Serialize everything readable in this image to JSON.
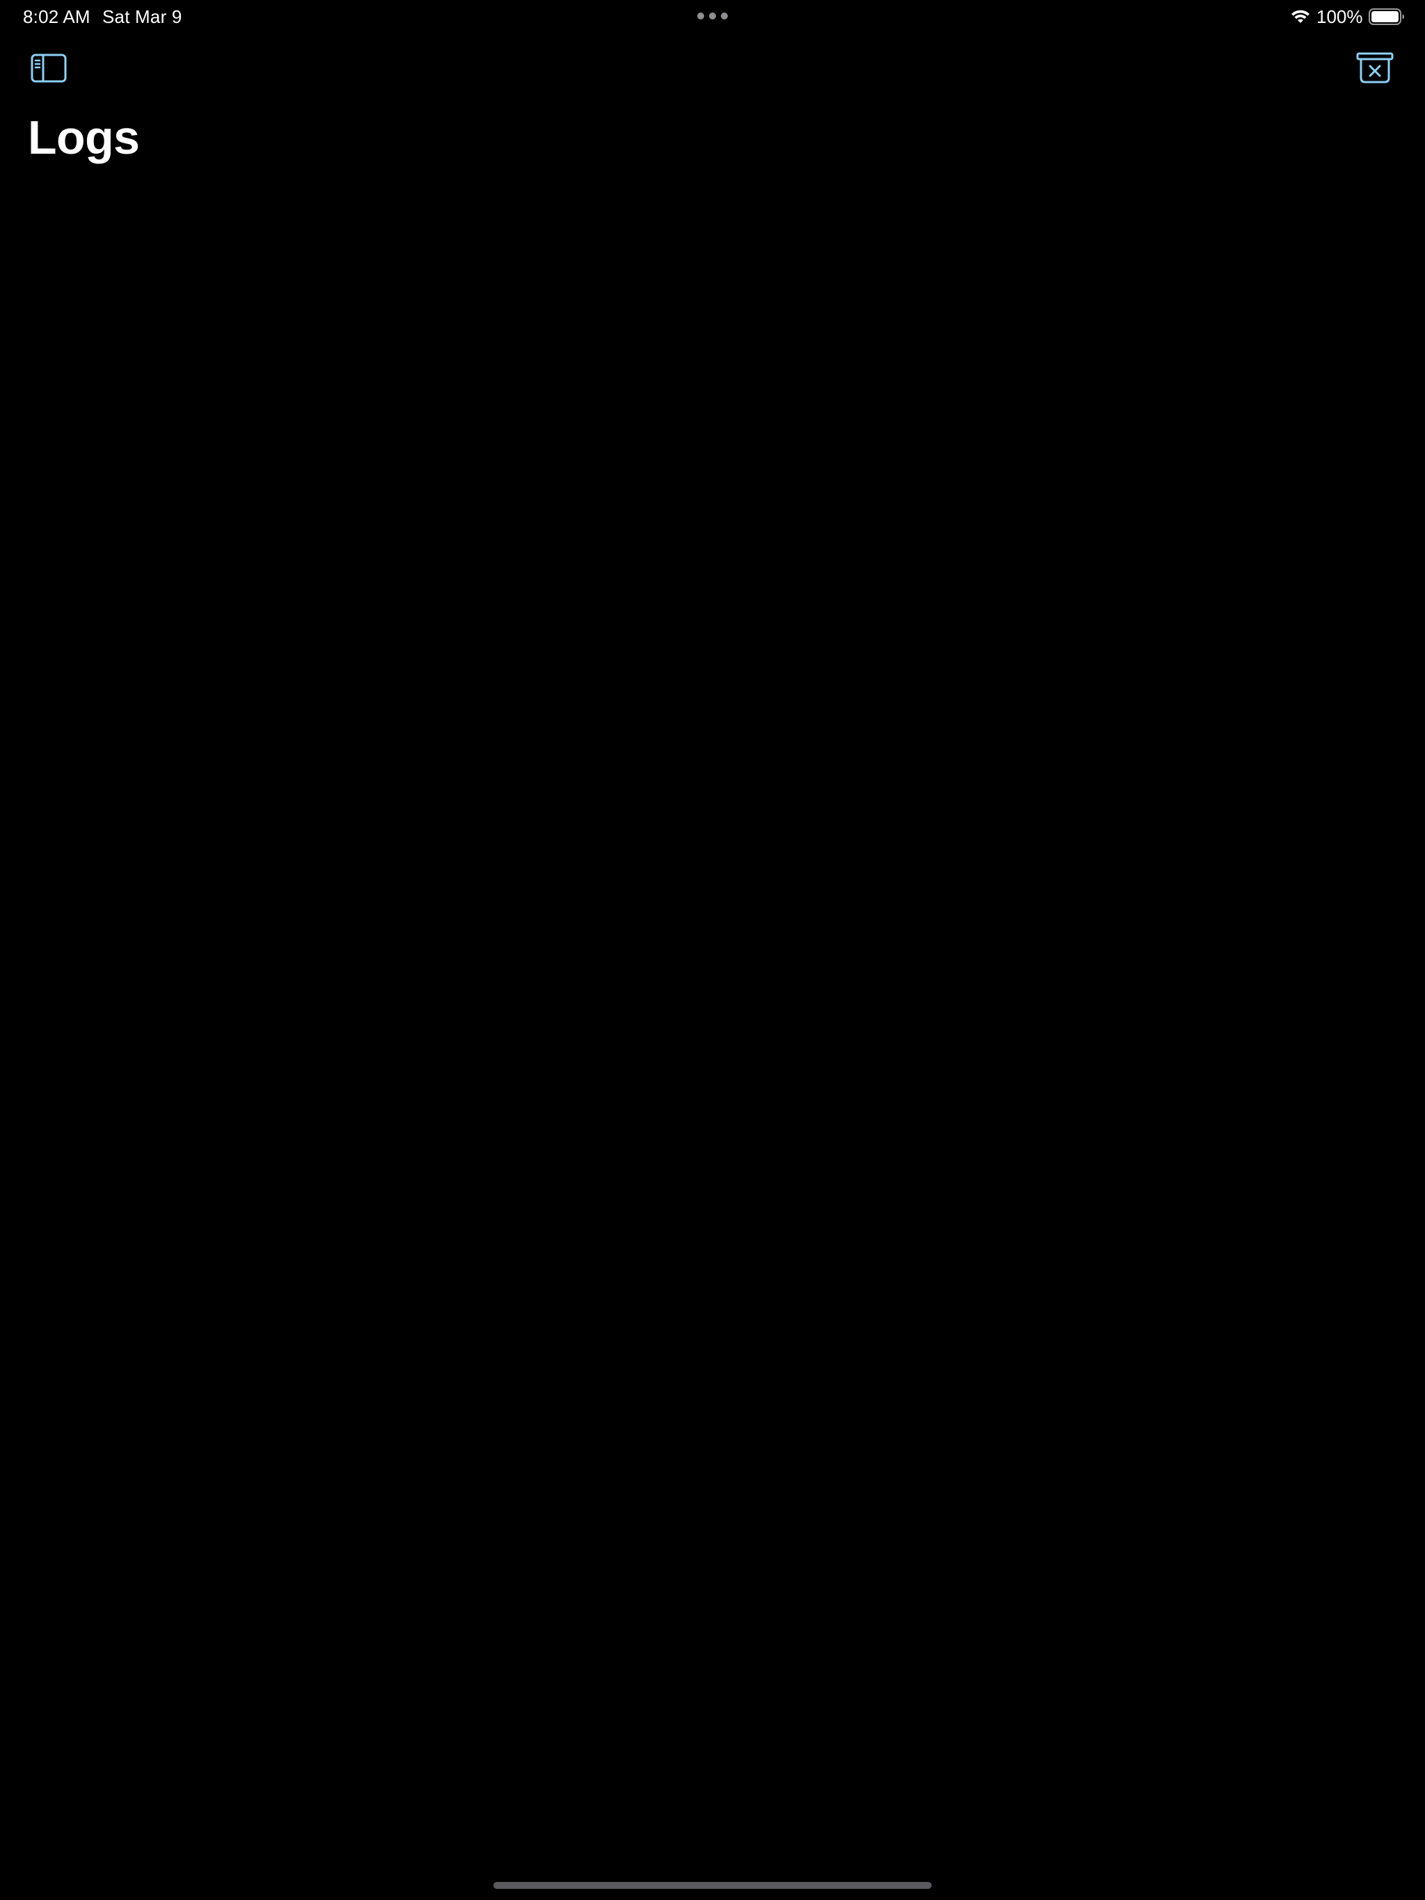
{
  "status_bar": {
    "time": "8:02 AM",
    "date": "Sat Mar 9",
    "battery_percent": "100%",
    "battery_level": 1.0,
    "icons": [
      "wifi-icon",
      "battery-icon",
      "multitask-dots-icon"
    ]
  },
  "toolbar": {
    "left_icon": "sidebar-toggle-icon",
    "right_icon": "clear-logs-icon",
    "accent_color": "#8ED0F5"
  },
  "page": {
    "title": "Logs"
  },
  "colors": {
    "background": "#000000",
    "text": "#FFFFFF",
    "accent": "#8ED0F5",
    "home_indicator": "#5A5A5E"
  }
}
